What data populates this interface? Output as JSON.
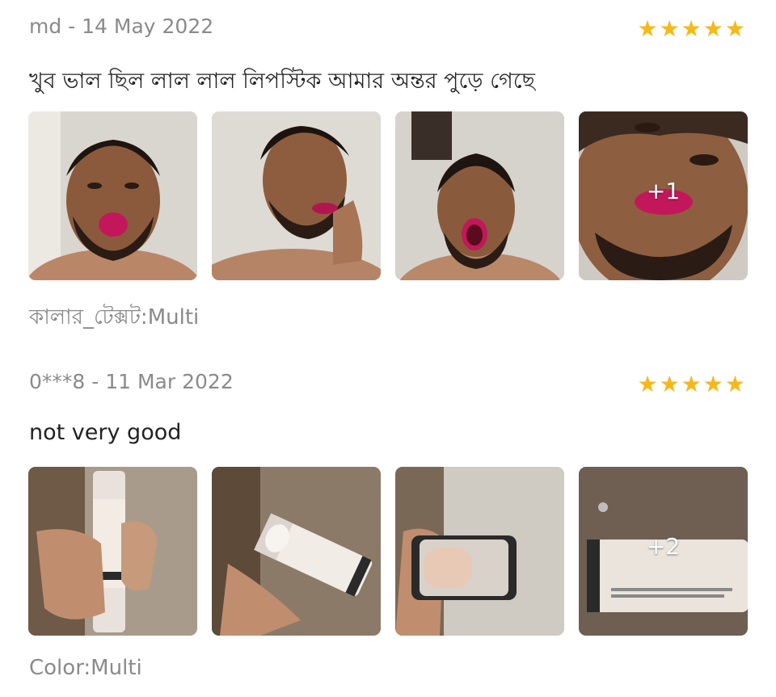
{
  "reviews": [
    {
      "author_date": "md - 14 May 2022",
      "rating": 5,
      "text": "খুব ভাল ছিল লাল লাল লিপস্টিক আমার অন্তর পুড়ে গেছে",
      "more_count": "+1",
      "sku": "কালার_টেক্সট:Multi"
    },
    {
      "author_date": "0***8 - 11 Mar 2022",
      "rating": 5,
      "text": "not very good",
      "more_count": "+2",
      "sku": "Color:Multi"
    }
  ],
  "icons": {
    "star": "star-icon"
  },
  "colors": {
    "star": "#f6b819",
    "meta": "#8a8a8a",
    "lipstick": "#c2185b"
  }
}
